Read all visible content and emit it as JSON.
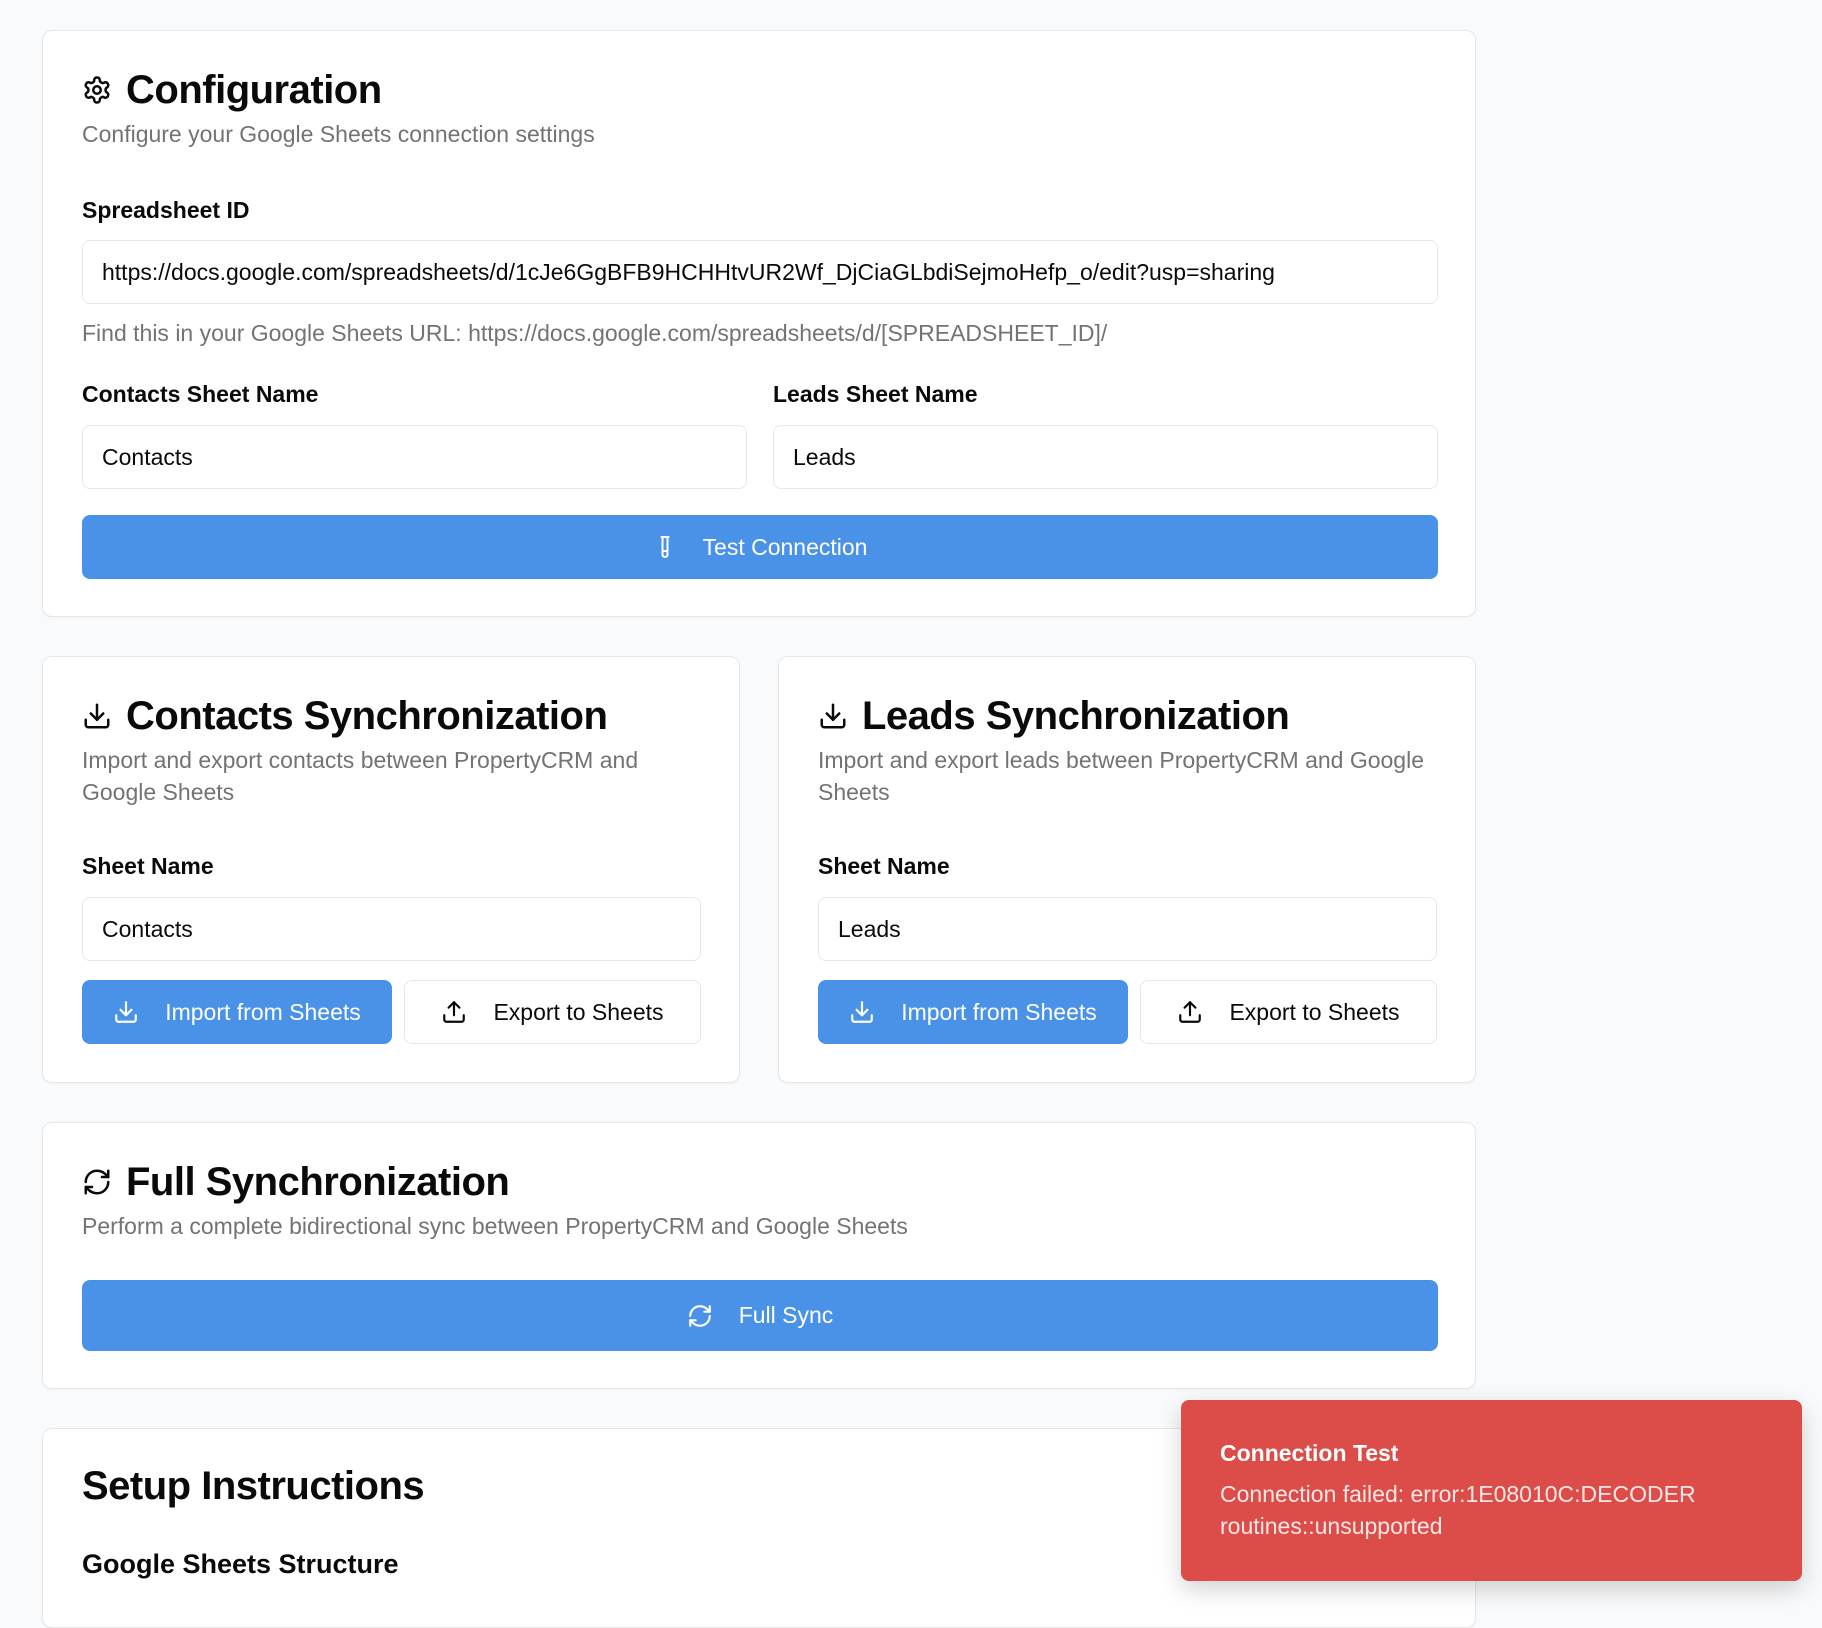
{
  "configuration": {
    "title": "Configuration",
    "description": "Configure your Google Sheets connection settings",
    "spreadsheet_id_label": "Spreadsheet ID",
    "spreadsheet_id_value": "https://docs.google.com/spreadsheets/d/1cJe6GgBFB9HCHHtvUR2Wf_DjCiaGLbdiSejmoHefp_o/edit?usp=sharing",
    "spreadsheet_id_hint": "Find this in your Google Sheets URL: https://docs.google.com/spreadsheets/d/[SPREADSHEET_ID]/",
    "contacts_sheet_label": "Contacts Sheet Name",
    "contacts_sheet_value": "Contacts",
    "leads_sheet_label": "Leads Sheet Name",
    "leads_sheet_value": "Leads",
    "test_button_label": "Test Connection"
  },
  "contacts_sync": {
    "title": "Contacts Synchronization",
    "description": "Import and export contacts between PropertyCRM and Google Sheets",
    "sheet_label": "Sheet Name",
    "sheet_value": "Contacts",
    "import_label": "Import from Sheets",
    "export_label": "Export to Sheets"
  },
  "leads_sync": {
    "title": "Leads Synchronization",
    "description": "Import and export leads between PropertyCRM and Google Sheets",
    "sheet_label": "Sheet Name",
    "sheet_value": "Leads",
    "import_label": "Import from Sheets",
    "export_label": "Export to Sheets"
  },
  "full_sync": {
    "title": "Full Synchronization",
    "description": "Perform a complete bidirectional sync between PropertyCRM and Google Sheets",
    "button_label": "Full Sync"
  },
  "setup": {
    "title": "Setup Instructions",
    "subtitle": "Google Sheets Structure"
  },
  "toast": {
    "title": "Connection Test",
    "message": "Connection failed: error:1E08010C:DECODER routines::unsupported"
  },
  "icons": {
    "configuration": "gear-icon",
    "test": "test-tube-icon",
    "sync_section": "download-icon",
    "import": "download-icon",
    "export": "upload-icon",
    "full_sync": "refresh-icon"
  },
  "colors": {
    "primary": "#4a92e8",
    "toast_error": "#dc4d49",
    "muted_text": "#737373",
    "border": "#e5e7eb",
    "background": "#f9fafb"
  }
}
